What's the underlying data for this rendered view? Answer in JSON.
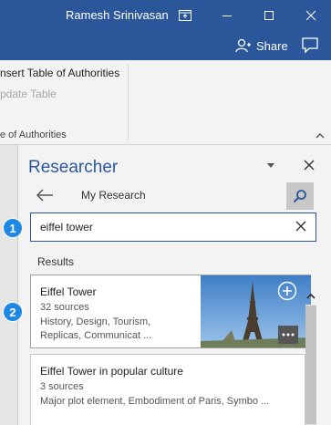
{
  "window": {
    "user_name": "Ramesh Srinivasan",
    "share_label": "Share"
  },
  "ribbon": {
    "insert_table_label": "nsert Table of Authorities",
    "update_table_label": "pdate Table",
    "group_label": "e of Authorities"
  },
  "researcher": {
    "title": "Researcher",
    "breadcrumb": "My Research",
    "search_value": "eiffel tower",
    "results_label": "Results",
    "results": [
      {
        "title": "Eiffel Tower",
        "sources": "32 sources",
        "description": "History, Design, Tourism, Replicas, Communicat ..."
      },
      {
        "title": "Eiffel Tower in popular culture",
        "sources": "3 sources",
        "description": "Major plot element, Embodiment of Paris, Symbo ..."
      }
    ]
  },
  "callouts": {
    "one": "1",
    "two": "2"
  },
  "colors": {
    "accent": "#2b579a",
    "callout": "#1e88e5"
  },
  "icons": [
    "restore-ribbon-icon",
    "minimize-icon",
    "maximize-icon",
    "close-icon",
    "share-person-icon",
    "comment-icon",
    "collapse-ribbon-icon",
    "dropdown-icon",
    "pane-close-icon",
    "back-arrow-icon",
    "search-icon",
    "clear-icon",
    "add-icon",
    "more-icon",
    "scroll-up-icon"
  ]
}
